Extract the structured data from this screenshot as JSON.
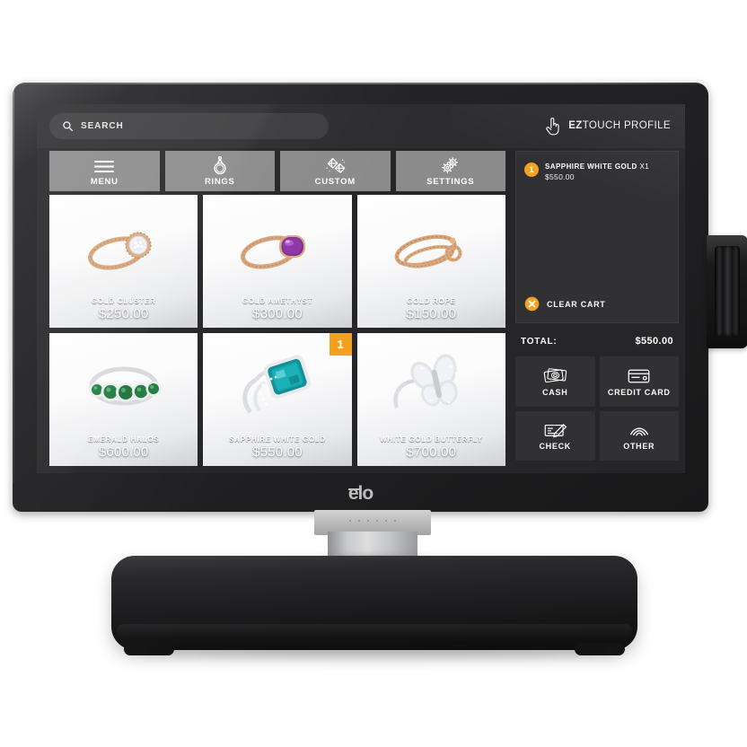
{
  "device": {
    "brand_logo": "elo",
    "side_peripheral": "magnetic-stripe-reader"
  },
  "screen": {
    "search": {
      "icon": "search-icon",
      "placeholder": "SEARCH",
      "value": ""
    },
    "profile": {
      "icon": "touch-hand-icon",
      "label_bold": "EZ",
      "label_rest": "TOUCH PROFILE"
    },
    "nav_tabs": [
      {
        "label": "MENU",
        "icon": "hamburger-menu-icon"
      },
      {
        "label": "RINGS",
        "icon": "ring-icon"
      },
      {
        "label": "CUSTOM",
        "icon": "gems-icon"
      },
      {
        "label": "SETTINGS",
        "icon": "gears-icon"
      }
    ],
    "products": [
      {
        "name": "GOLD CLUSTER",
        "price": "$250.00",
        "badge": ""
      },
      {
        "name": "GOLD AMETHYST",
        "price": "$300.00",
        "badge": ""
      },
      {
        "name": "GOLD ROPE",
        "price": "$150.00",
        "badge": ""
      },
      {
        "name": "EMERALD HALOS",
        "price": "$600.00",
        "badge": ""
      },
      {
        "name": "SAPPHIRE WHITE GOLD",
        "price": "$550.00",
        "badge": "1"
      },
      {
        "name": "WHITE GOLD BUTTERFLY",
        "price": "$700.00",
        "badge": ""
      }
    ],
    "cart": {
      "item": {
        "badge": "1",
        "name": "SAPPHIRE WHITE GOLD",
        "quantity": "X1",
        "price": "$550.00"
      },
      "clear_cart": {
        "icon": "x-circle-icon",
        "label": "CLEAR CART"
      },
      "total_label": "TOTAL:",
      "total_value": "$550.00",
      "payment_buttons": [
        {
          "label": "CASH",
          "icon": "cash-icon"
        },
        {
          "label": "CREDIT CARD",
          "icon": "credit-card-icon"
        },
        {
          "label": "CHECK",
          "icon": "check-icon"
        },
        {
          "label": "OTHER",
          "icon": "contactless-icon"
        }
      ]
    }
  },
  "colors": {
    "accent_orange": "#f2a01e",
    "nav_tab_gray": "#8a8a8a",
    "panel_dark": "#2f2f31",
    "screen_bg": "#232325"
  }
}
